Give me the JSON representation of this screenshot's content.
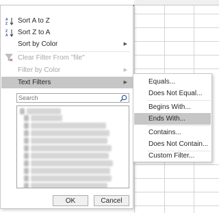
{
  "menu": {
    "sort_az": "Sort A to Z",
    "sort_za": "Sort Z to A",
    "sort_by_color": "Sort by Color",
    "clear_filter": "Clear Filter From \"file\"",
    "filter_by_color": "Filter by Color",
    "text_filters": "Text Filters"
  },
  "search": {
    "placeholder": "Search"
  },
  "buttons": {
    "ok": "OK",
    "cancel": "Cancel"
  },
  "submenu": {
    "items": [
      "Equals...",
      "Does Not Equal...",
      "Begins With...",
      "Ends With...",
      "Contains...",
      "Does Not Contain...",
      "Custom Filter..."
    ]
  },
  "colors": {
    "active_highlight": "#c6c6c6",
    "excel_green": "#217346",
    "sort_icon": "#2b579a"
  }
}
